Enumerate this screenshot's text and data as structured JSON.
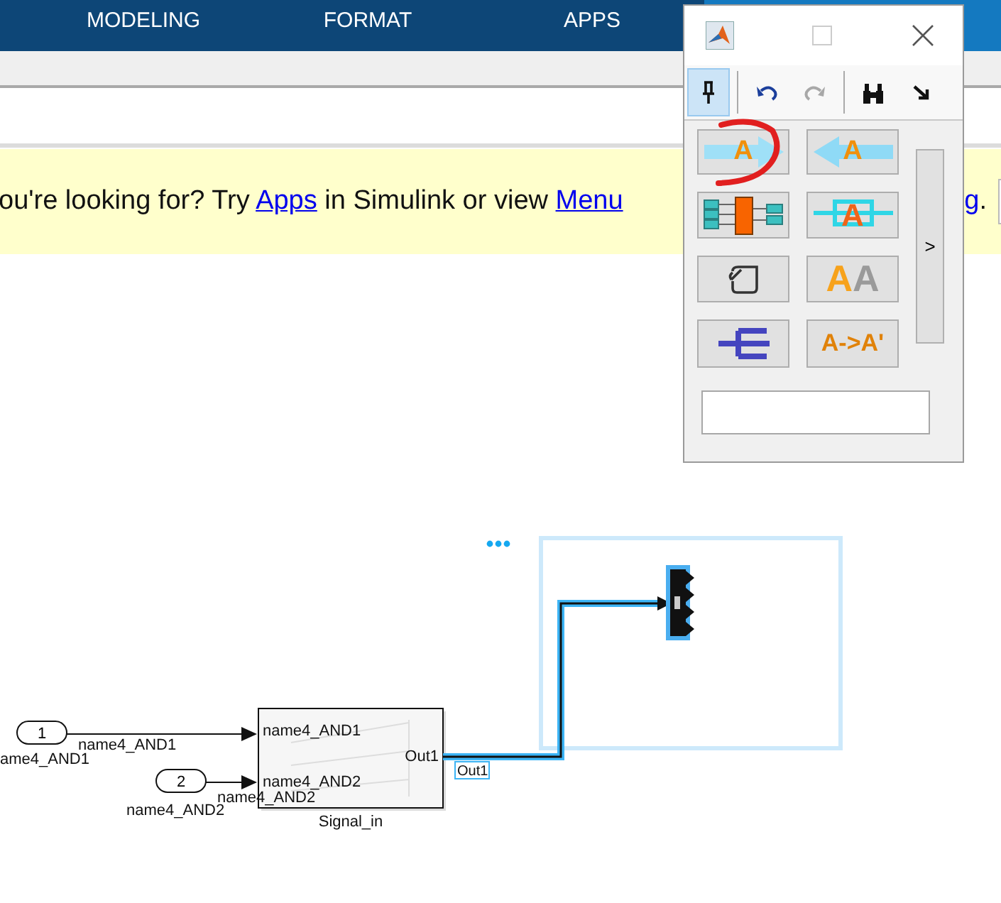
{
  "ribbon": {
    "tabs": [
      {
        "label": "MODELING",
        "selected": false
      },
      {
        "label": "FORMAT",
        "selected": false
      },
      {
        "label": "APPS",
        "selected": false
      },
      {
        "selected": true
      }
    ]
  },
  "banner": {
    "message": [
      {
        "kind": "text",
        "text": "ou're looking for? Try "
      },
      {
        "kind": "link",
        "text": "Apps"
      },
      {
        "kind": "text",
        "text": " in Simulink or view "
      },
      {
        "kind": "link",
        "text": "Menu"
      }
    ],
    "tail": [
      {
        "kind": "link",
        "text": "g"
      },
      {
        "kind": "text",
        "text": "."
      }
    ]
  },
  "palette": {
    "toolbar": [
      {
        "kind": "pin",
        "pressed": true,
        "disabled": false
      },
      {
        "kind": "undo",
        "pressed": false,
        "disabled": false
      },
      {
        "kind": "redo",
        "pressed": false,
        "disabled": true
      },
      {
        "kind": "find",
        "pressed": false,
        "disabled": false
      },
      {
        "kind": "expand",
        "pressed": false,
        "disabled": false
      }
    ],
    "buttons": [
      {
        "kind": "arrow-right",
        "letters": [
          "A"
        ]
      },
      {
        "kind": "arrow-left",
        "letters": [
          "A"
        ]
      },
      {
        "kind": "bus"
      },
      {
        "kind": "through",
        "letters": [
          "A"
        ]
      },
      {
        "kind": "comment"
      },
      {
        "kind": "double",
        "letters": [
          "A",
          "A"
        ]
      },
      {
        "kind": "bar"
      },
      {
        "kind": "text",
        "letters": [
          "A->A'"
        ]
      }
    ],
    "side_button": {
      "label": ">"
    }
  },
  "diagram": {
    "inports": [
      {
        "number": "1",
        "name": "ame4_AND1",
        "signal": "name4_AND1"
      },
      {
        "number": "2",
        "name": "name4_AND2",
        "signal": "name4_AND2"
      }
    ],
    "block": {
      "name": "Signal_in",
      "inputs": [
        "name4_AND1",
        "name4_AND2"
      ],
      "outputs": [
        "Out1"
      ]
    },
    "output_signal": {
      "label": "Out1",
      "selected": true
    }
  }
}
